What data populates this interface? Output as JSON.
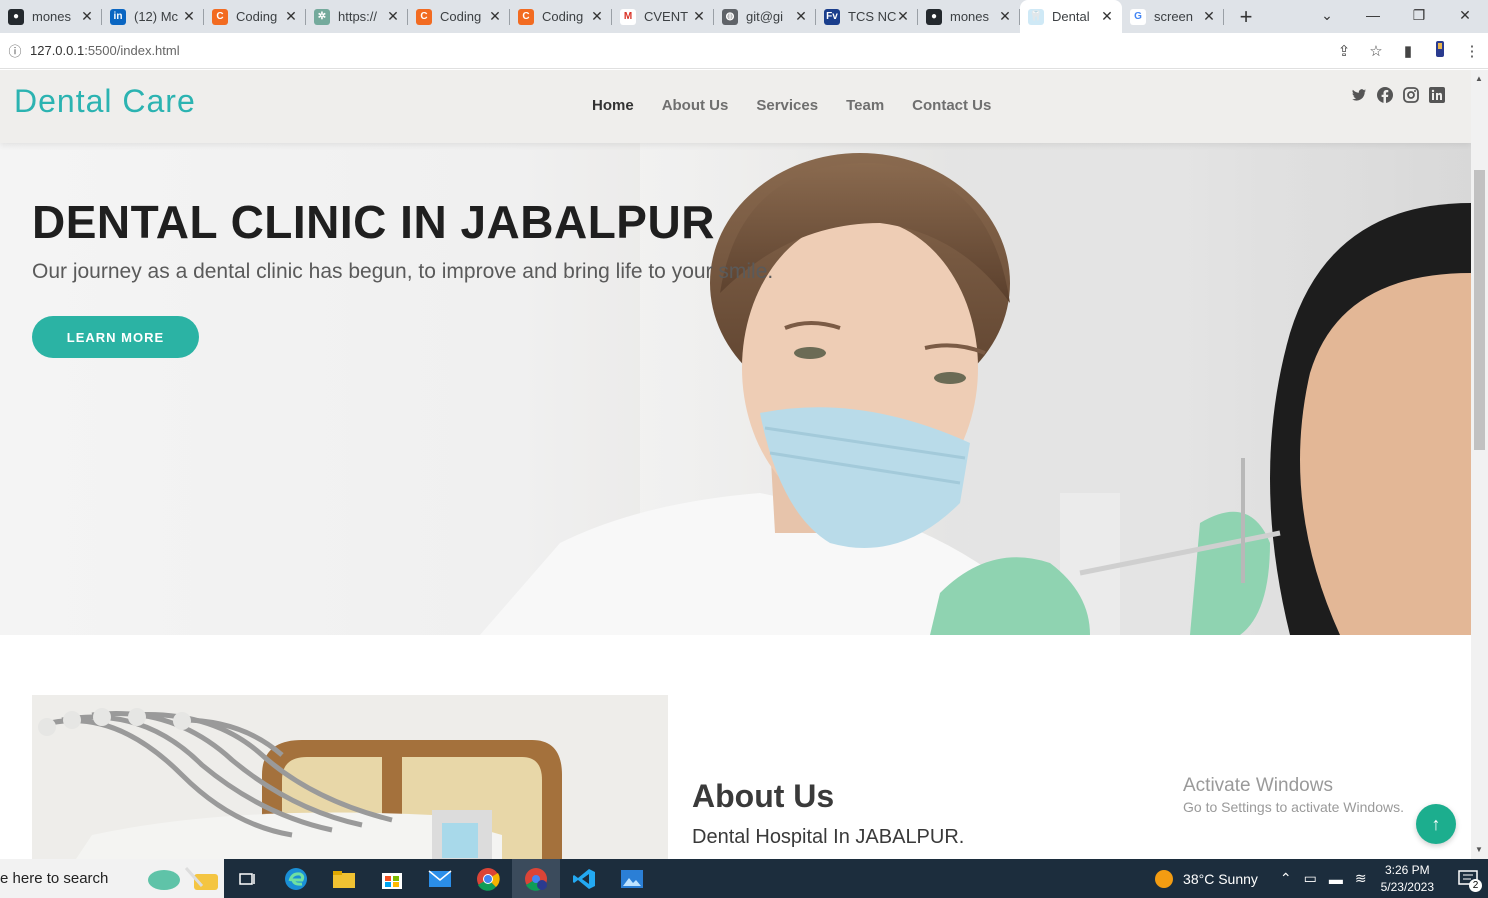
{
  "browser": {
    "tabs": [
      {
        "title": "mones",
        "fav": "github-icon"
      },
      {
        "title": "(12) Mc",
        "fav": "linkedin-icon"
      },
      {
        "title": "Coding",
        "fav": "coding-icon"
      },
      {
        "title": "https://",
        "fav": "chatgpt-icon"
      },
      {
        "title": "Coding",
        "fav": "coding-icon"
      },
      {
        "title": "Coding",
        "fav": "coding-icon"
      },
      {
        "title": "CVENT",
        "fav": "gmail-icon"
      },
      {
        "title": "git@gi",
        "fav": "globe-icon"
      },
      {
        "title": "TCS NC",
        "fav": "fv-icon"
      },
      {
        "title": "mones",
        "fav": "github-icon"
      },
      {
        "title": "Dental",
        "fav": "tooth-icon",
        "active": true
      },
      {
        "title": "screen",
        "fav": "google-icon"
      }
    ],
    "new_tab": "+",
    "url_host": "127.0.0.1",
    "url_rest": ":5500/index.html"
  },
  "site": {
    "logo": "Dental Care",
    "nav": [
      "Home",
      "About Us",
      "Services",
      "Team",
      "Contact Us"
    ],
    "social": [
      "twitter-icon",
      "facebook-icon",
      "instagram-icon",
      "linkedin-icon"
    ],
    "hero": {
      "title": "DENTAL CLINIC IN JABALPUR",
      "subtitle": "Our journey as a dental clinic has begun, to improve and bring life to your smile.",
      "button": "LEARN MORE"
    },
    "about": {
      "title": "About Us",
      "subtitle": "Dental Hospital In JABALPUR."
    }
  },
  "overlay": {
    "activate_title": "Activate Windows",
    "activate_sub": "Go to Settings to activate Windows."
  },
  "taskbar": {
    "search_placeholder": "e here to search",
    "weather": "38°C  Sunny",
    "time": "3:26 PM",
    "date": "5/23/2023",
    "notifications": "2"
  },
  "colors": {
    "brand": "#2bb3b1",
    "button": "#2bb3a4",
    "taskbar": "#1c2d3d"
  }
}
